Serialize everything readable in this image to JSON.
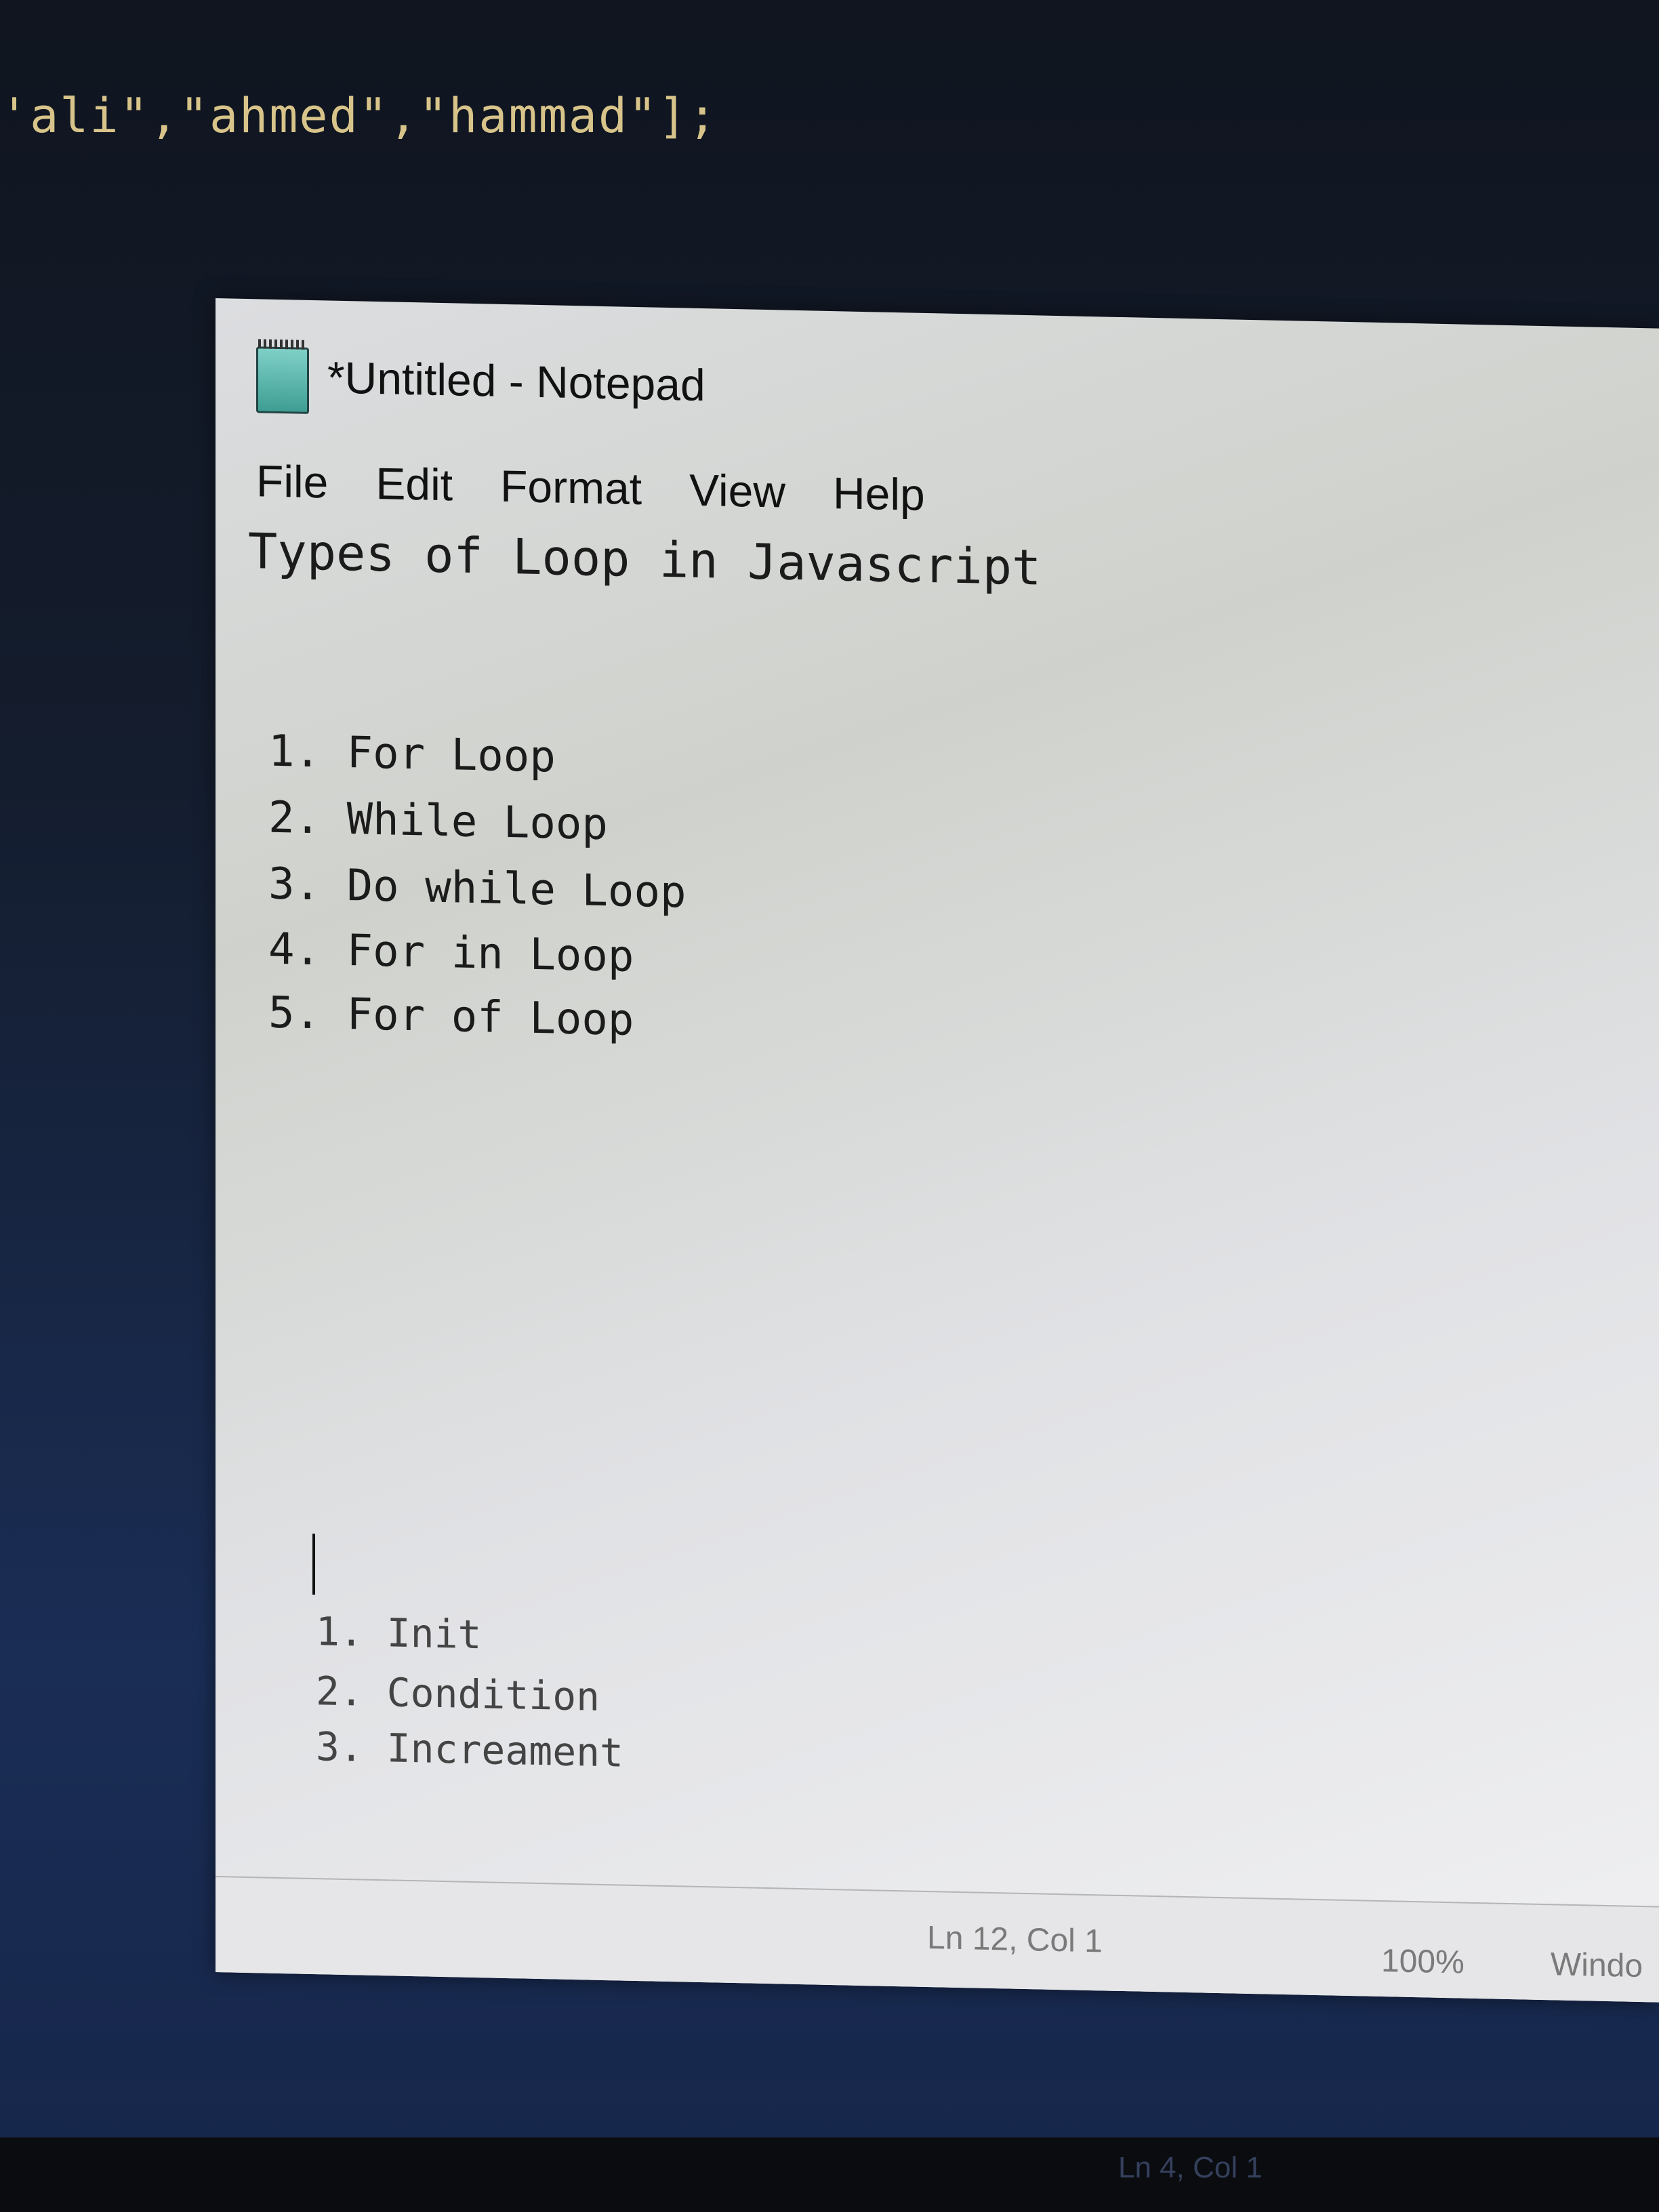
{
  "background_editor": {
    "code_line": "'ali\",\"ahmed\",\"hammad\"];"
  },
  "window": {
    "title": "*Untitled - Notepad",
    "icon": "notepad-icon"
  },
  "menu": [
    {
      "label": "File"
    },
    {
      "label": "Edit"
    },
    {
      "label": "Format"
    },
    {
      "label": "View"
    },
    {
      "label": "Help"
    }
  ],
  "document": {
    "heading": "Types of Loop in Javascript",
    "loops": [
      "1. For Loop",
      "2. While Loop",
      "3. Do while Loop",
      "4. For in Loop",
      "5. For of Loop"
    ],
    "parts": [
      "1. Init",
      "2. Condition",
      "3. Increament"
    ]
  },
  "status": {
    "position": "Ln 12, Col 1",
    "zoom": "100%",
    "line_ending": "Windo"
  },
  "taskbar": {
    "status": "Ln 4, Col 1"
  }
}
